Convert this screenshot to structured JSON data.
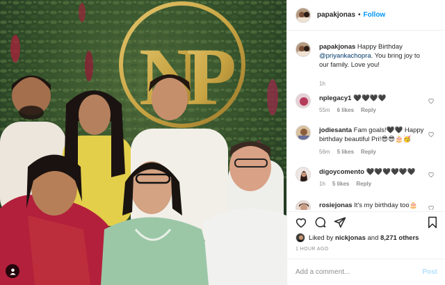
{
  "post": {
    "author": "papakjonas",
    "follow_label": "Follow",
    "separator": "•"
  },
  "caption": {
    "username": "papakjonas",
    "text_before": " Happy Birthday ",
    "mention": "@priyankachopra",
    "text_after": ". You bring joy to our family. Love you!",
    "time": "1h"
  },
  "comments": [
    {
      "username": "nplegacy1",
      "text": "🖤🖤🖤🖤",
      "time": "55m",
      "likes": "6 likes",
      "reply": "Reply"
    },
    {
      "username": "jodiesanta",
      "text": "Fam goals!🖤🖤 Happy birthday beautiful Pri!😎😎🎂🥳",
      "time": "56m",
      "likes": "5 likes",
      "reply": "Reply"
    },
    {
      "username": "digoycomento",
      "text": "🖤🖤🖤🖤🖤🖤",
      "time": "1h",
      "likes": "5 likes",
      "reply": "Reply"
    },
    {
      "username": "rosiejonas",
      "text": "It's my birthday too🎂",
      "time": "",
      "likes": "",
      "reply": ""
    }
  ],
  "likes": {
    "prefix": "Liked by ",
    "user": "nickjonas",
    "middle": " and ",
    "count": "8,271 others"
  },
  "time_ago": "1 HOUR AGO",
  "add_comment": {
    "placeholder": "Add a comment...",
    "post_label": "Post"
  },
  "photo": {
    "monogram": "NP"
  },
  "icons": {
    "like": "heart-icon",
    "comment": "comment-bubble-icon",
    "share": "paper-plane-icon",
    "save": "bookmark-icon",
    "user_tags": "user-tag-icon",
    "comment_like": "small-heart-icon"
  },
  "colors": {
    "link_blue": "#0095f6",
    "mention_blue": "#00376b",
    "muted_text": "#8e8e8e",
    "disabled_post": "#b2dffc",
    "gold_monogram": "#c9a544"
  }
}
